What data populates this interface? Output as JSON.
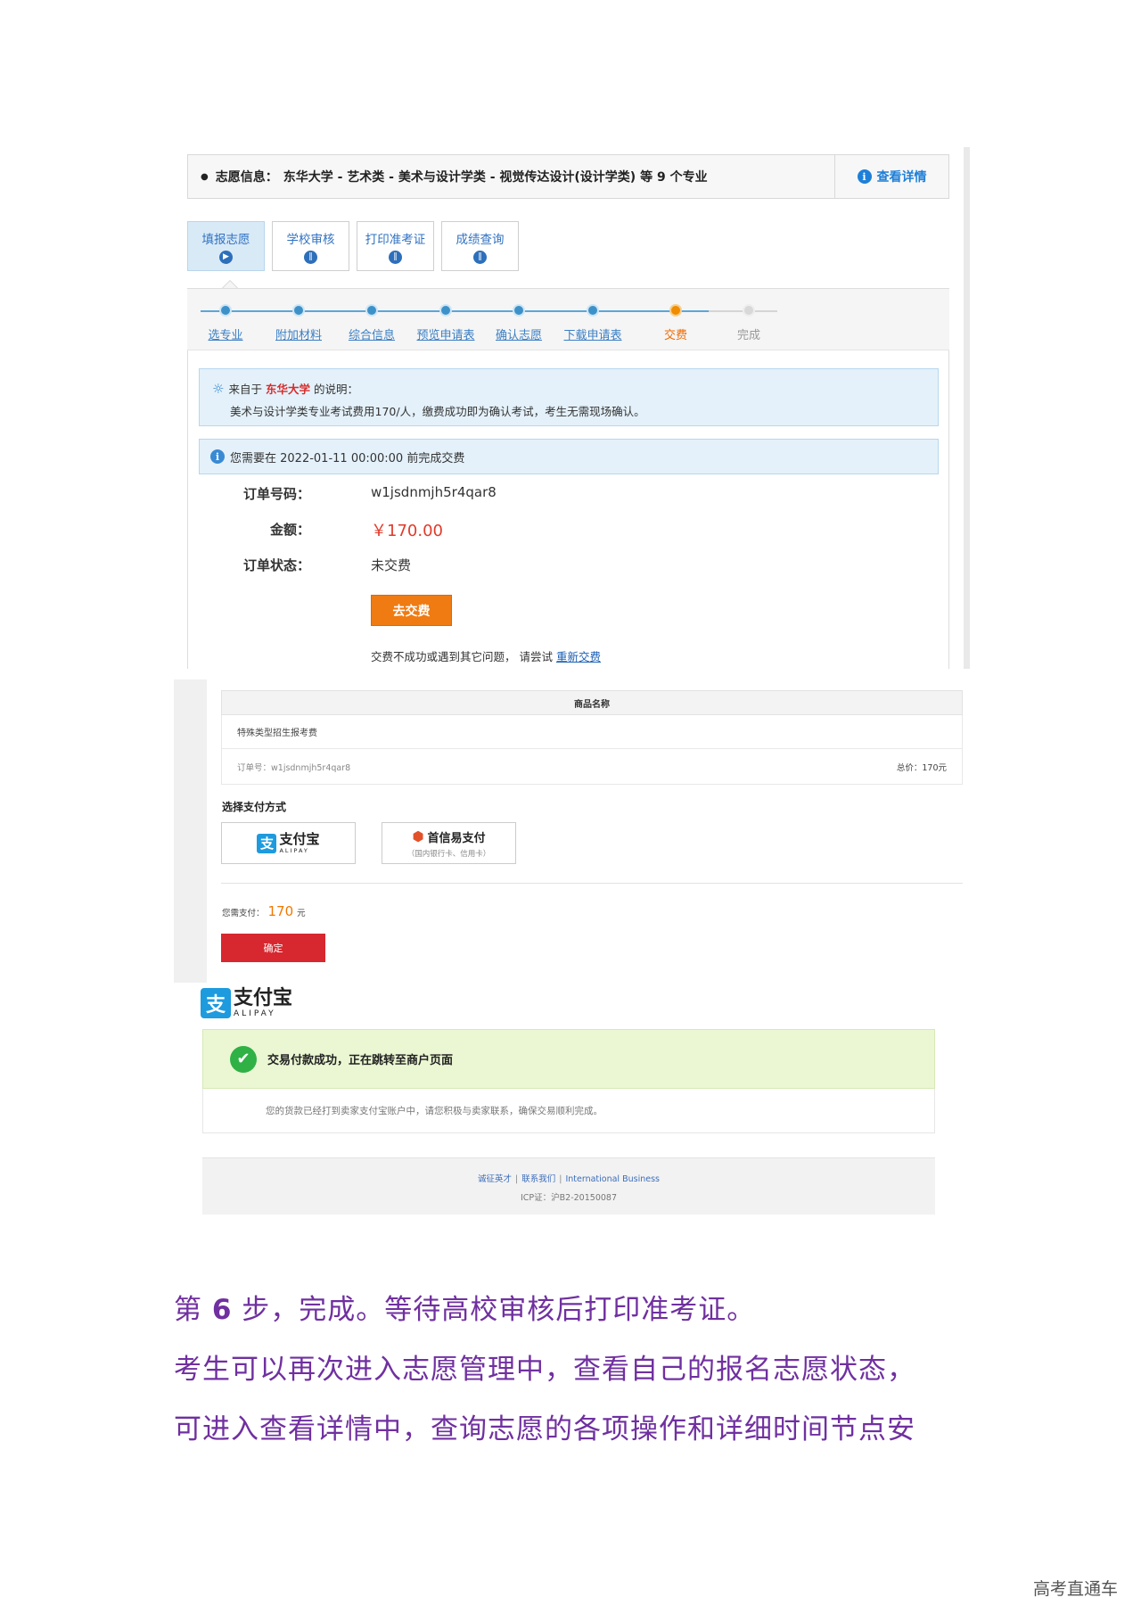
{
  "panel1": {
    "info_label": "志愿信息：",
    "info_text": "东华大学 - 艺术类 - 美术与设计学类 - 视觉传达设计(设计学类) 等 9 个专业",
    "detail_link": "查看详情",
    "tabs": [
      {
        "label": "填报志愿",
        "icon": "play-icon"
      },
      {
        "label": "学校审核",
        "icon": "pause-icon"
      },
      {
        "label": "打印准考证",
        "icon": "pause-icon"
      },
      {
        "label": "成绩查询",
        "icon": "pause-icon"
      }
    ],
    "steps": [
      "选专业",
      "附加材料",
      "综合信息",
      "预览申请表",
      "确认志愿",
      "下载申请表",
      "交费",
      "完成"
    ],
    "note": {
      "prefix": "来自于",
      "university": "东华大学",
      "suffix": "的说明：",
      "body": "美术与设计学类专业考试费用170/人，缴费成功即为确认考试，考生无需现场确认。"
    },
    "deadline": "您需要在 2022-01-11 00:00:00 前完成交费",
    "order_no_label": "订单号码：",
    "order_no": "w1jsdnmjh5r4qar8",
    "amount_label": "金额：",
    "amount": "￥170.00",
    "status_label": "订单状态：",
    "status": "未交费",
    "pay_button": "去交费",
    "retry_text": "交费不成功或遇到其它问题， 请尝试",
    "retry_link": "重新交费"
  },
  "panel2": {
    "goods_header": "商品名称",
    "goods_name": "特殊类型招生报考费",
    "order_ref": "订单号：w1jsdnmjh5r4qar8",
    "total": "总价：170元",
    "method_title": "选择支付方式",
    "alipay_cn": "支付宝",
    "alipay_en": "ALIPAY",
    "sxy_name": "首信易支付",
    "sxy_sub": "（国内银行卡、信用卡）",
    "need_pay_label": "您需支付：",
    "need_pay_amount": "170",
    "need_pay_unit": "元",
    "confirm_button": "确定"
  },
  "panel3": {
    "brand_cn": "支付宝",
    "brand_en": "ALIPAY",
    "success_text": "交易付款成功，正在跳转至商户页面",
    "success_sub": "您的货款已经打到卖家支付宝账户中，请您积极与卖家联系，确保交易顺利完成。",
    "footer_links": [
      "诚征英才",
      "联系我们",
      "International Business"
    ],
    "icp": "ICP证：沪B2-20150087"
  },
  "text": {
    "line1_pre": "第",
    "line1_num": "6",
    "line1_post": "步，完成。等待高校审核后打印准考证。",
    "line2": "考生可以再次进入志愿管理中，查看自己的报名志愿状态，",
    "line3": "可进入查看详情中，查询志愿的各项操作和详细时间节点安"
  },
  "watermark": "高考直通车"
}
